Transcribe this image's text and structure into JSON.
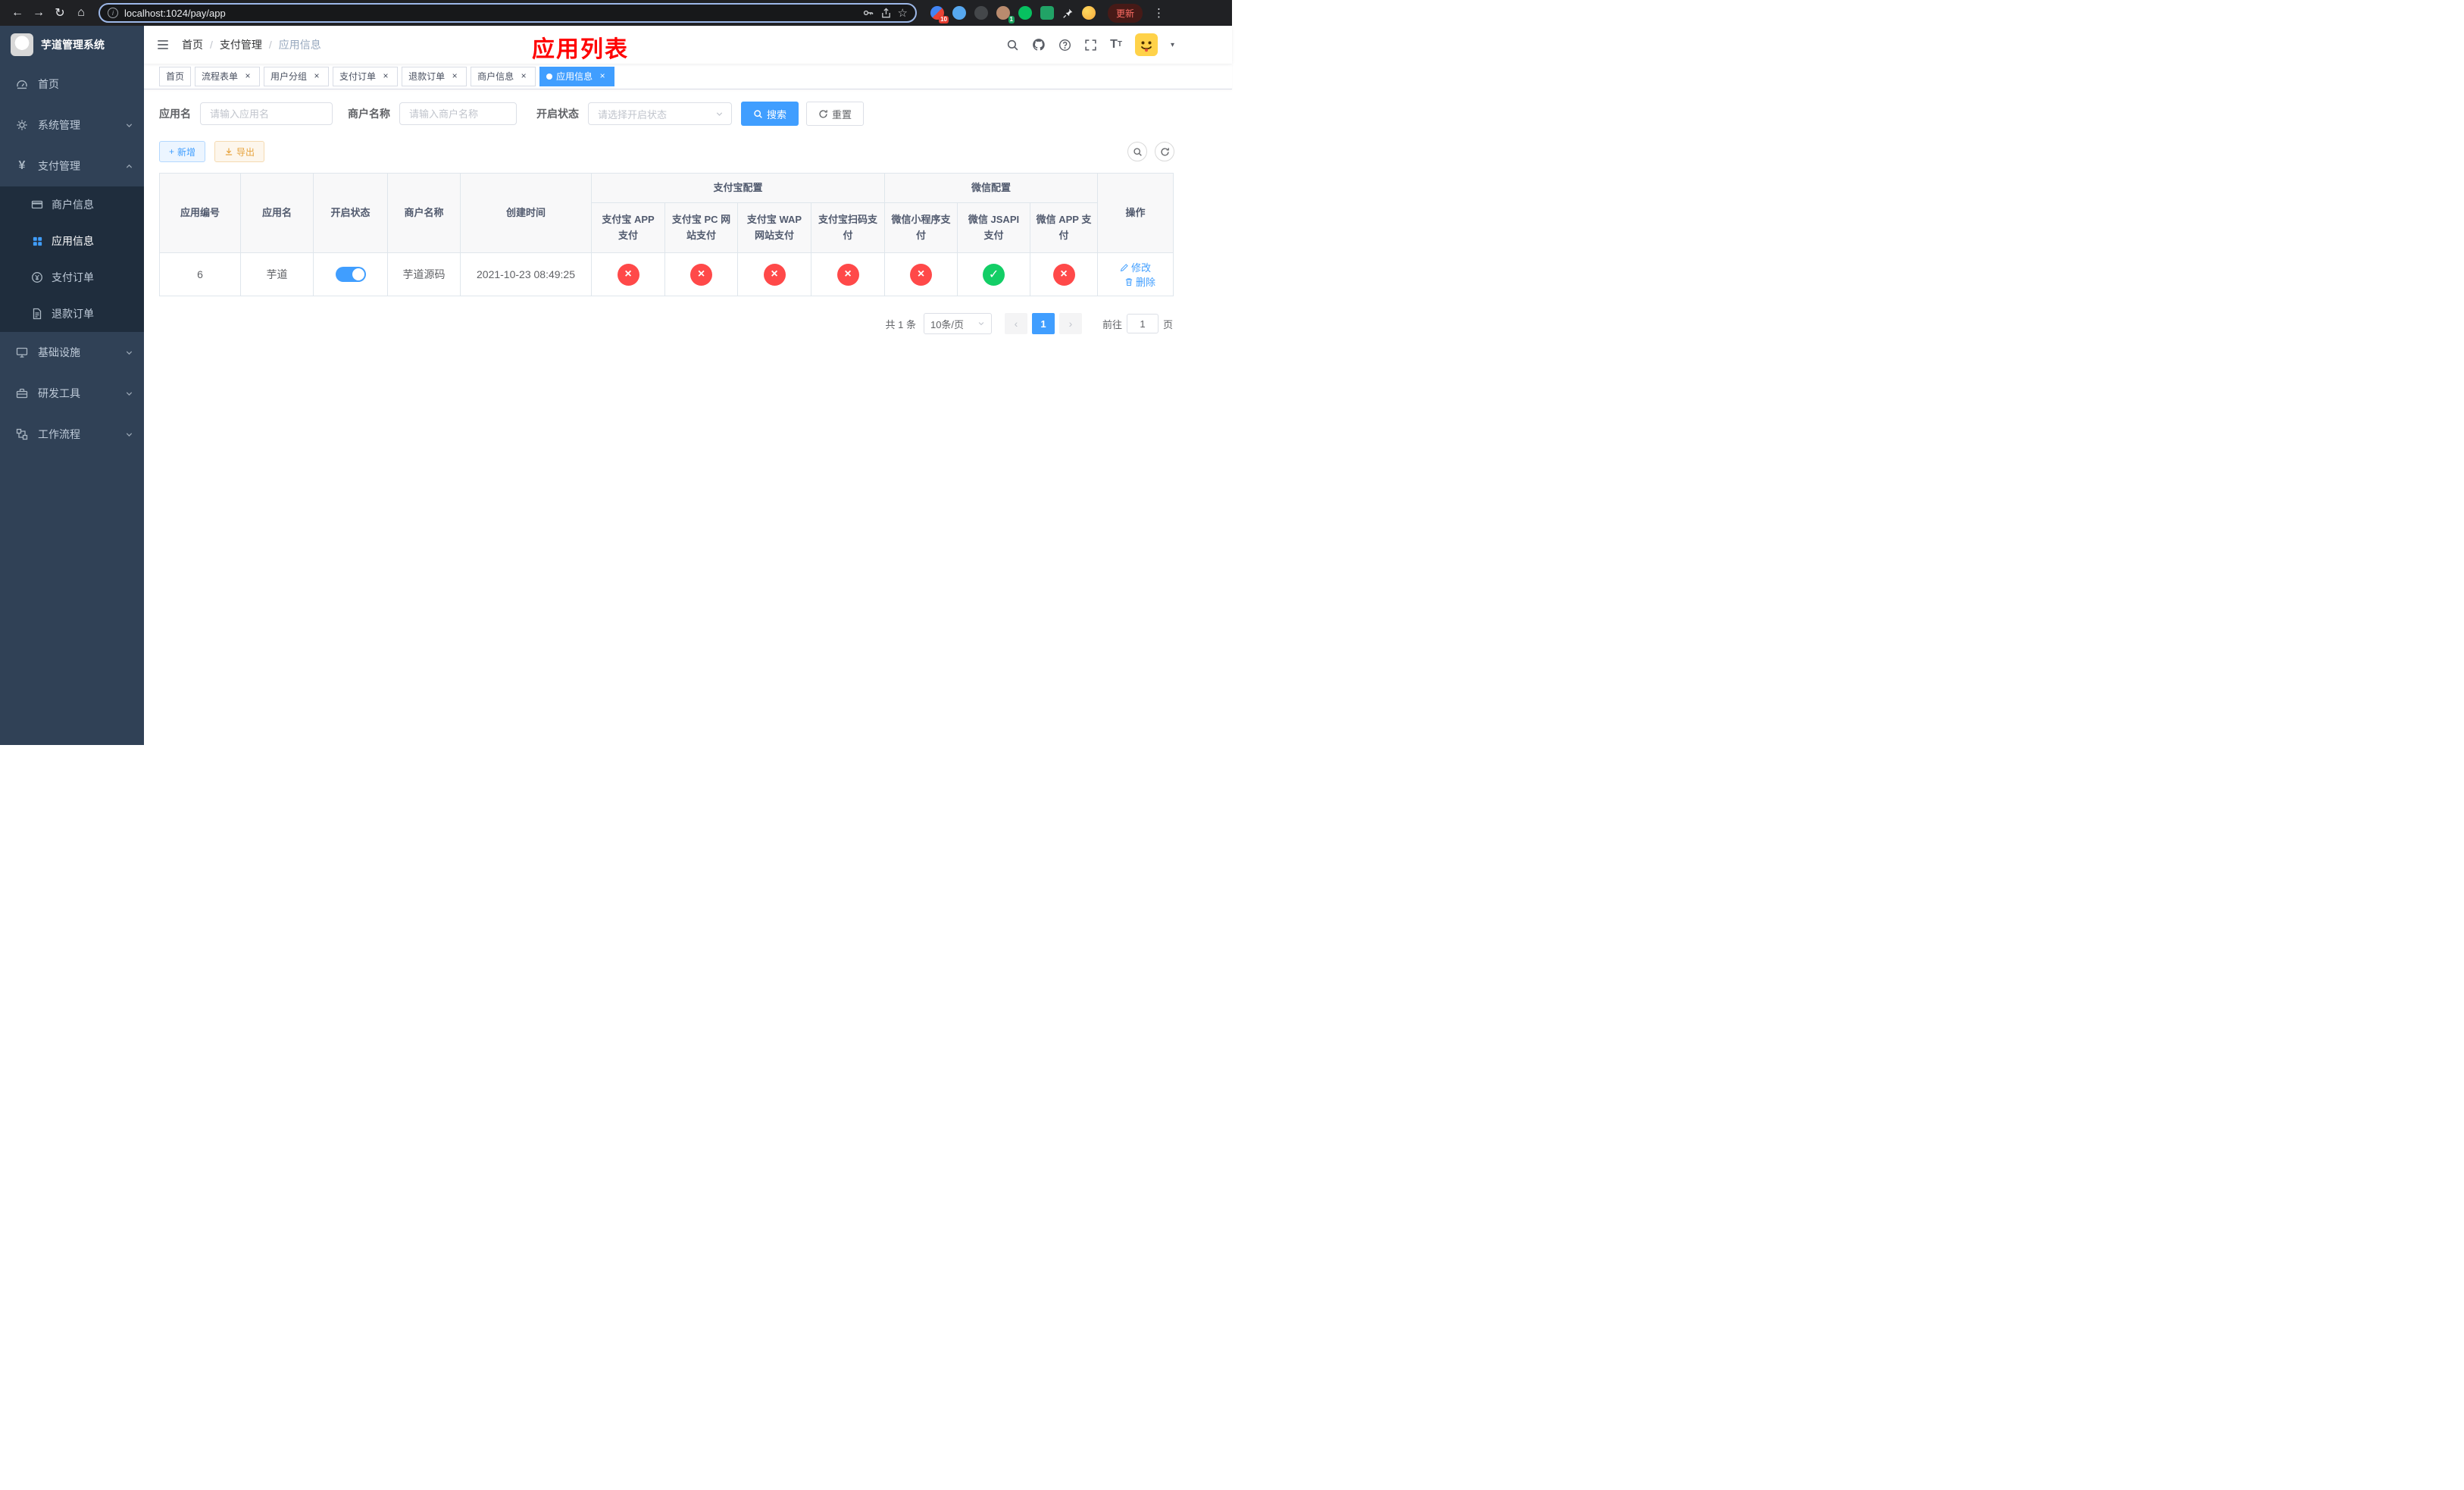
{
  "browser": {
    "url": "localhost:1024/pay/app",
    "update_label": "更新",
    "extensions": {
      "badge_a": "10",
      "badge_b": "1"
    }
  },
  "icons": {
    "back": "←",
    "forward": "→",
    "reload": "↻",
    "home": "⌂",
    "info": "i",
    "star": "☆",
    "overflow": "⋮",
    "caret": "▾",
    "plus": "+",
    "close": "×",
    "check": "✓",
    "slash": "/",
    "prev": "‹",
    "next": "›",
    "text_size_big": "T",
    "text_size_small": "T"
  },
  "sidebar": {
    "title": "芋道管理系统",
    "menu": [
      {
        "label": "首页"
      },
      {
        "label": "系统管理"
      },
      {
        "label": "支付管理",
        "children": [
          {
            "label": "商户信息"
          },
          {
            "label": "应用信息",
            "active": true
          },
          {
            "label": "支付订单"
          },
          {
            "label": "退款订单"
          }
        ]
      },
      {
        "label": "基础设施"
      },
      {
        "label": "研发工具"
      },
      {
        "label": "工作流程"
      }
    ]
  },
  "header": {
    "breadcrumb": [
      "首页",
      "支付管理",
      "应用信息"
    ],
    "page_title": "应用列表"
  },
  "tabs": [
    {
      "label": "首页",
      "closable": false,
      "active": false
    },
    {
      "label": "流程表单",
      "closable": true,
      "active": false
    },
    {
      "label": "用户分组",
      "closable": true,
      "active": false
    },
    {
      "label": "支付订单",
      "closable": true,
      "active": false
    },
    {
      "label": "退款订单",
      "closable": true,
      "active": false
    },
    {
      "label": "商户信息",
      "closable": true,
      "active": false
    },
    {
      "label": "应用信息",
      "closable": true,
      "active": true
    }
  ],
  "filters": {
    "app_name": {
      "label": "应用名",
      "placeholder": "请输入应用名",
      "value": ""
    },
    "merchant_name": {
      "label": "商户名称",
      "placeholder": "请输入商户名称",
      "value": ""
    },
    "status": {
      "label": "开启状态",
      "placeholder": "请选择开启状态",
      "value": ""
    },
    "search_label": "搜索",
    "reset_label": "重置"
  },
  "toolbar": {
    "add_label": "新增",
    "export_label": "导出"
  },
  "table": {
    "groups": {
      "alipay": "支付宝配置",
      "wechat": "微信配置"
    },
    "columns": {
      "id": "应用编号",
      "name": "应用名",
      "status": "开启状态",
      "merchant": "商户名称",
      "created": "创建时间",
      "alipay_app": "支付宝 APP 支付",
      "alipay_pc": "支付宝 PC 网站支付",
      "alipay_wap": "支付宝 WAP 网站支付",
      "alipay_qr": "支付宝扫码支付",
      "wx_lite": "微信小程序支付",
      "wx_jsapi": "微信 JSAPI 支付",
      "wx_app": "微信 APP 支付",
      "actions": "操作"
    },
    "rows": [
      {
        "id": "6",
        "name": "芋道",
        "enabled": true,
        "merchant": "芋道源码",
        "created": "2021-10-23 08:49:25",
        "alipay_app": false,
        "alipay_pc": false,
        "alipay_wap": false,
        "alipay_qr": false,
        "wx_lite": false,
        "wx_jsapi": true,
        "wx_app": false,
        "edit_label": "修改",
        "delete_label": "删除"
      }
    ]
  },
  "pagination": {
    "total": "共 1 条",
    "page_size": "10条/页",
    "current_page": "1",
    "goto_label": "前往",
    "goto_value": "1",
    "page_unit": "页"
  },
  "colors": {
    "accent": "#409eff",
    "success": "#13ce66",
    "danger": "#ff4949",
    "warning": "#e6a23c",
    "title_red": "#ff0000",
    "sidebar_bg": "#304156",
    "sidebar_sub_bg": "#1f2d3d"
  }
}
